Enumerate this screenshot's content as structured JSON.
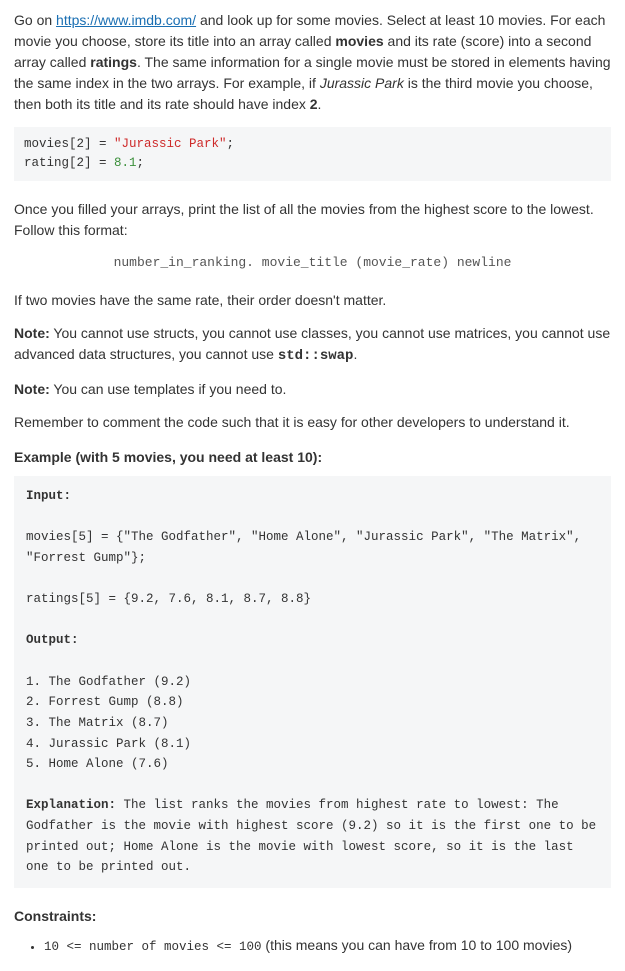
{
  "intro": {
    "p1_a": "Go on ",
    "link": "https://www.imdb.com/",
    "p1_b": " and look up for some movies. Select at least 10 movies. For each movie you choose, store its title into an array called ",
    "arr1": "movies",
    "p1_c": " and its rate (score) into a second array called ",
    "arr2": "ratings",
    "p1_d": ". The same information for a single movie must be stored in elements having the same index in the two arrays. For example, if ",
    "jp": "Jurassic Park",
    "p1_e": " is the third movie you choose, then both its title and its rate should have index ",
    "idx": "2",
    "p1_f": "."
  },
  "code1": {
    "l1a": "movies[2] = ",
    "l1b": "\"Jurassic Park\"",
    "l1c": ";",
    "l2a": "rating[2] = ",
    "l2b": "8.1",
    "l2c": ";"
  },
  "para2": "Once you filled your arrays, print the list of all the movies from the highest score to the lowest. Follow this format:",
  "format_line": "number_in_ranking. movie_title (movie_rate) newline",
  "para3": "If two movies have the same rate, their order doesn't matter.",
  "note1_label": "Note:",
  "note1_a": " You cannot use structs, you cannot use classes, you cannot use matrices, you cannot use advanced data structures, you cannot use ",
  "note1_code": "std::swap",
  "note1_b": ".",
  "note2_label": "Note:",
  "note2_text": " You can use templates if you need to.",
  "para4": "Remember to comment the code such that it is easy for other developers to understand it.",
  "example_heading": "Example (with 5 movies, you need at least 10):",
  "example": {
    "input_label": "Input:",
    "movies_line": "movies[5] = {\"The Godfather\", \"Home Alone\", \"Jurassic Park\", \"The Matrix\", \"Forrest Gump\"};",
    "ratings_line": "ratings[5] = {9.2, 7.6, 8.1, 8.7, 8.8}",
    "output_label": "Output:",
    "o1": "1. The Godfather (9.2)",
    "o2": "2. Forrest Gump (8.8)",
    "o3": "3. The Matrix (8.7)",
    "o4": "4. Jurassic Park (8.1)",
    "o5": "5. Home Alone (7.6)",
    "explain_label": "Explanation:",
    "explain_text": " The list ranks the movies from highest rate to lowest: The Godfather is the movie with highest score (9.2) so it is the first one to be printed out; Home Alone is the movie with lowest score, so it is the last one to be printed out."
  },
  "constraints": {
    "heading": "Constraints:",
    "c1_code": "10 <= number of movies <= 100",
    "c1_text": " (this means you can have from 10 to 100 movies)"
  }
}
